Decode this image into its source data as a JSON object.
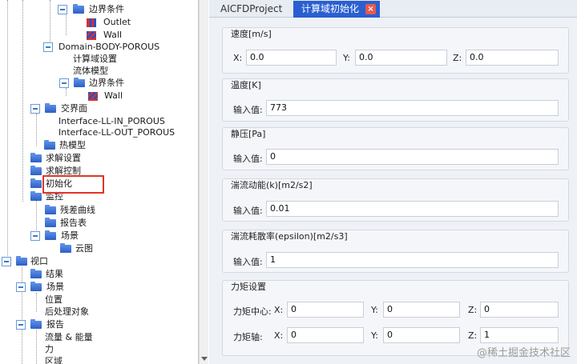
{
  "tree": {
    "items": [
      {
        "label": "边界条件"
      },
      {
        "label": "Outlet"
      },
      {
        "label": "Wall"
      },
      {
        "label": "Domain-BODY-POROUS"
      },
      {
        "label": "计算域设置"
      },
      {
        "label": "流体模型"
      },
      {
        "label": "边界条件"
      },
      {
        "label": "Wall"
      },
      {
        "label": "交界面"
      },
      {
        "label": "Interface-LL-IN_POROUS"
      },
      {
        "label": "Interface-LL-OUT_POROUS"
      },
      {
        "label": "热模型"
      },
      {
        "label": "求解设置"
      },
      {
        "label": "求解控制"
      },
      {
        "label": "初始化"
      },
      {
        "label": "监控"
      },
      {
        "label": "残差曲线"
      },
      {
        "label": "报告表"
      },
      {
        "label": "场景"
      },
      {
        "label": "云图"
      },
      {
        "label": "视口"
      },
      {
        "label": "结果"
      },
      {
        "label": "场景"
      },
      {
        "label": "位置"
      },
      {
        "label": "后处理对象"
      },
      {
        "label": "报告"
      },
      {
        "label": "流量 & 能量"
      },
      {
        "label": "力"
      },
      {
        "label": "区域"
      }
    ]
  },
  "tabs": {
    "project": "AICFDProject",
    "init": "计算域初始化",
    "close_glyph": "×"
  },
  "form": {
    "velocity": {
      "title": "速度[m/s]",
      "x_label": "X:",
      "x_value": "0.0",
      "y_label": "Y:",
      "y_value": "0.0",
      "z_label": "Z:",
      "z_value": "0.0"
    },
    "temperature": {
      "title": "温度[K]",
      "input_label": "输入值:",
      "value": "773"
    },
    "static_pressure": {
      "title": "静压[Pa]",
      "input_label": "输入值:",
      "value": "0"
    },
    "tke": {
      "title": "湍流动能(k)[m2/s2]",
      "input_label": "输入值:",
      "value": "0.01"
    },
    "epsilon": {
      "title": "湍流耗散率(epsilon)[m2/s3]",
      "input_label": "输入值:",
      "value": "1"
    },
    "moment": {
      "title": "力矩设置",
      "center_label": "力矩中心:",
      "axis_label": "力矩轴:",
      "x_label": "X:",
      "y_label": "Y:",
      "z_label": "Z:",
      "center_x": "0",
      "center_y": "0",
      "center_z": "0",
      "axis_x": "0",
      "axis_y": "0",
      "axis_z": "1"
    }
  },
  "watermark": "@稀土掘金技术社区"
}
